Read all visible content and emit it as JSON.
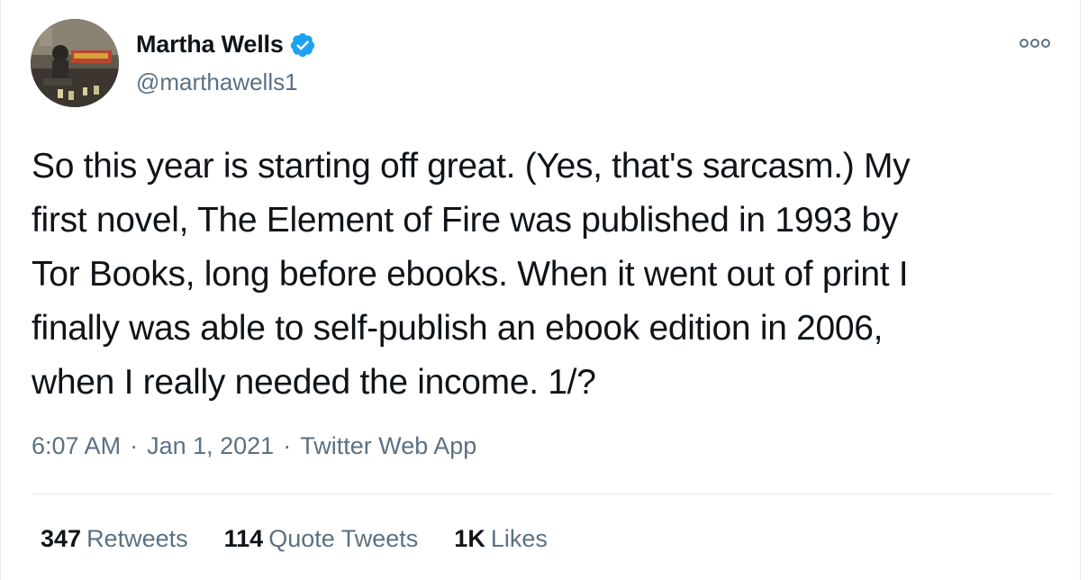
{
  "author": {
    "display_name": "Martha Wells",
    "handle": "@marthawells1",
    "verified_icon": "verified-badge-icon",
    "verified_color": "#1da1f2"
  },
  "menu": {
    "icon": "more-options-icon"
  },
  "tweet": {
    "text": "So this year is starting off great. (Yes, that's sarcasm.) My\nfirst novel, The Element of Fire was published in 1993 by\nTor Books, long before ebooks. When it went out of print I\nfinally was able to self-publish an ebook edition in 2006,\nwhen I really needed the income. 1/?",
    "time": "6:07 AM",
    "date": "Jan 1, 2021",
    "source": "Twitter Web App",
    "separator": "·"
  },
  "stats": {
    "retweets_count": "347",
    "retweets_label": "Retweets",
    "quotes_count": "114",
    "quotes_label": "Quote Tweets",
    "likes_count": "1K",
    "likes_label": "Likes"
  },
  "colors": {
    "text_primary": "#0f1419",
    "text_secondary": "#5b7083",
    "divider": "#e6ecf0"
  }
}
